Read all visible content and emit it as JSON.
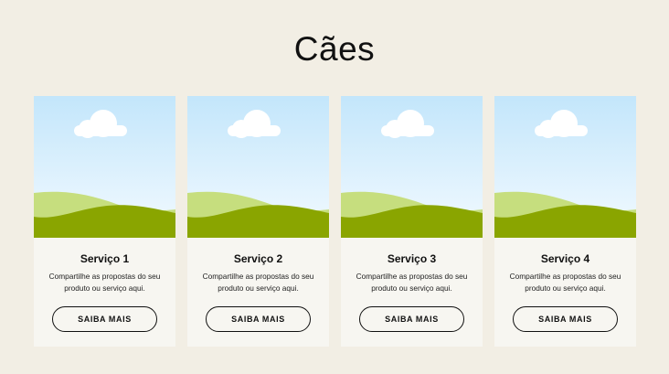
{
  "page": {
    "title": "Cães"
  },
  "cards": [
    {
      "title": "Serviço 1",
      "description": "Compartilhe as propostas do seu produto ou serviço aqui.",
      "button_label": "SAIBA MAIS",
      "image_icon": "landscape-placeholder-icon"
    },
    {
      "title": "Serviço 2",
      "description": "Compartilhe as propostas do seu produto ou serviço aqui.",
      "button_label": "SAIBA MAIS",
      "image_icon": "landscape-placeholder-icon"
    },
    {
      "title": "Serviço 3",
      "description": "Compartilhe as propostas do seu produto ou serviço aqui.",
      "button_label": "SAIBA MAIS",
      "image_icon": "landscape-placeholder-icon"
    },
    {
      "title": "Serviço 4",
      "description": "Compartilhe as propostas do seu produto ou serviço aqui.",
      "button_label": "SAIBA MAIS",
      "image_icon": "landscape-placeholder-icon"
    }
  ],
  "colors": {
    "background": "#f2eee4",
    "card_background": "#f7f6f1",
    "sky_top": "#c3e6fb",
    "sky_bottom": "#f3faff",
    "hill_light": "#c6de7e",
    "hill_dark": "#8aa500",
    "cloud": "#ffffff"
  }
}
